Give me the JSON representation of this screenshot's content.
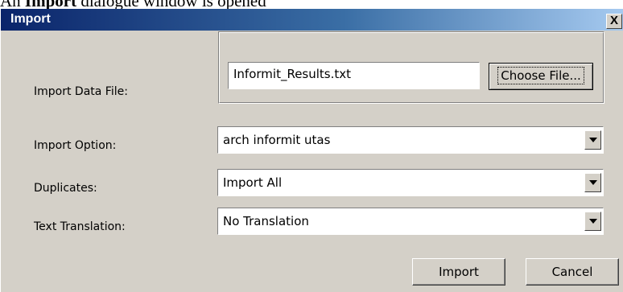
{
  "caption": {
    "prefix": "An ",
    "bold": "Import",
    "suffix": " dialogue window is opened"
  },
  "dialog": {
    "title": "Import",
    "close_label": "X"
  },
  "import_data_file": {
    "label": "Import Data File:",
    "value": "Informit_Results.txt",
    "choose_button": "Choose File..."
  },
  "import_option": {
    "label": "Import Option:",
    "selected": "arch informit utas"
  },
  "duplicates": {
    "label": "Duplicates:",
    "selected": "Import All"
  },
  "text_translation": {
    "label": "Text Translation:",
    "selected": "No Translation"
  },
  "buttons": {
    "import": "Import",
    "cancel": "Cancel"
  },
  "icons": {
    "dropdown": "chevron-down-icon",
    "close": "close-icon"
  },
  "colors": {
    "title_gradient_start": "#0a246a",
    "title_gradient_end": "#a6caf0",
    "dialog_face": "#d4d0c8"
  }
}
